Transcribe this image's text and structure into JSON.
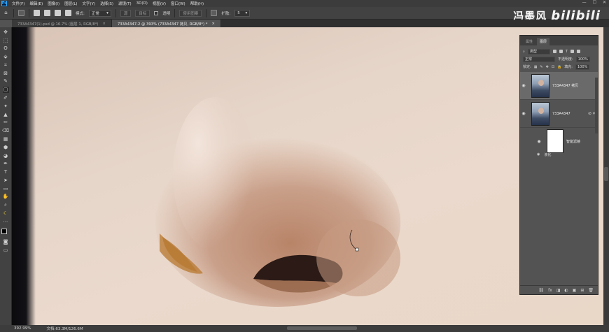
{
  "app": {
    "logo": "Ps"
  },
  "menu": [
    "文件(F)",
    "编辑(E)",
    "图像(I)",
    "图层(L)",
    "文字(Y)",
    "选择(S)",
    "滤镜(T)",
    "3D(D)",
    "视图(V)",
    "窗口(W)",
    "帮助(H)"
  ],
  "window_controls": [
    "—",
    "☐",
    "✕"
  ],
  "options_bar": {
    "mode_label": "模式:",
    "mode_value": "正常",
    "gradient_label": "源",
    "dest_label": "目标",
    "transparent_label": "透明",
    "use_pattern_label": "使用图案",
    "diffusion_label": "扩散:",
    "diffusion_value": "5"
  },
  "watermark": {
    "name": "冯墨风",
    "brand": "bilibili"
  },
  "tabs": [
    {
      "label": "733A4347(1).psd @ 16.7% (图层 1, RGB/8*)",
      "close": "×",
      "active": false
    },
    {
      "label": "733A4347-2 @ 393% (733A4347 拷贝, RGB/8*) *",
      "close": "×",
      "active": true
    }
  ],
  "tools": [
    "✥",
    "⬚",
    "ʘ",
    "⬙",
    "⌗",
    "⊠",
    "✎",
    "▢",
    "✐",
    "✦",
    "▲",
    "✏",
    "⌫",
    "▦",
    "⬢",
    "◕",
    "✒",
    "T",
    "➤",
    "▭",
    "✋",
    "⌕",
    "☾",
    "⋯"
  ],
  "layers_panel": {
    "tabs": [
      "属性",
      "图层"
    ],
    "filter_label": "类型",
    "blend_mode": "正常",
    "opacity_label": "不透明度:",
    "opacity_value": "100%",
    "lock_label": "锁定:",
    "fill_label": "填充:",
    "fill_value": "100%",
    "layers": [
      {
        "name": "733A4347 拷贝",
        "selected": true
      },
      {
        "name": "733A4347",
        "selected": false
      }
    ],
    "smart_filter_label": "智能滤镜",
    "filter_name": "液化",
    "footer_icons": [
      "⛓",
      "fx",
      "◨",
      "◐",
      "▣",
      "⊞",
      "🗑"
    ]
  },
  "status": {
    "zoom": "392.99%",
    "doc_info": "文档:63.3M/126.6M"
  },
  "colors": {
    "menubar": "#3c3c3c",
    "panel": "#535353",
    "accent": "#31a8ff"
  }
}
